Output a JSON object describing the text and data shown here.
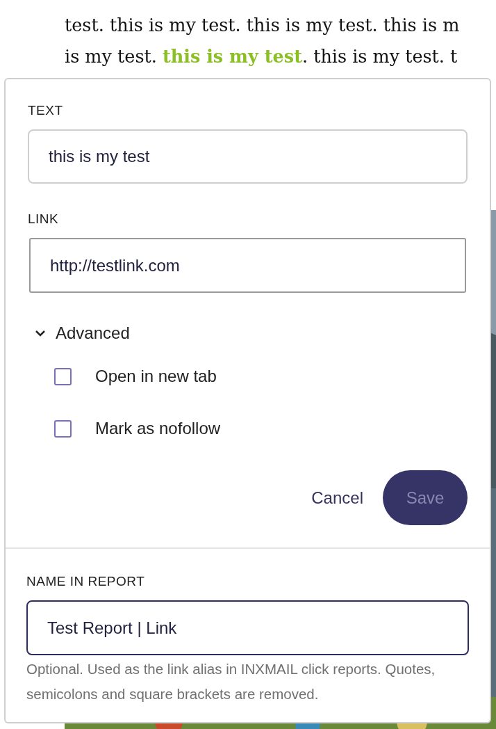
{
  "article": {
    "lines": [
      "test. this is my test. this is my test. this is m",
      "is my test. **this is my test**. this is my test. t"
    ]
  },
  "link_popup": {
    "text_label": "TEXT",
    "text_value": "this is my test",
    "link_label": "LINK",
    "link_value": "http://testlink.com",
    "advanced": {
      "label": "Advanced",
      "expanded": true,
      "options": [
        {
          "label": "Open in new tab",
          "checked": false
        },
        {
          "label": "Mark as nofollow",
          "checked": false
        }
      ]
    },
    "cancel": "Cancel",
    "save": {
      "label": "Save",
      "disabled": true
    },
    "report_label": "NAME IN REPORT",
    "report_value": "Test Report | Link",
    "report_focused": true,
    "help": "Optional. Used as the link alias in INXMAIL click reports. Quotes, semicolons and square brackets are removed."
  }
}
